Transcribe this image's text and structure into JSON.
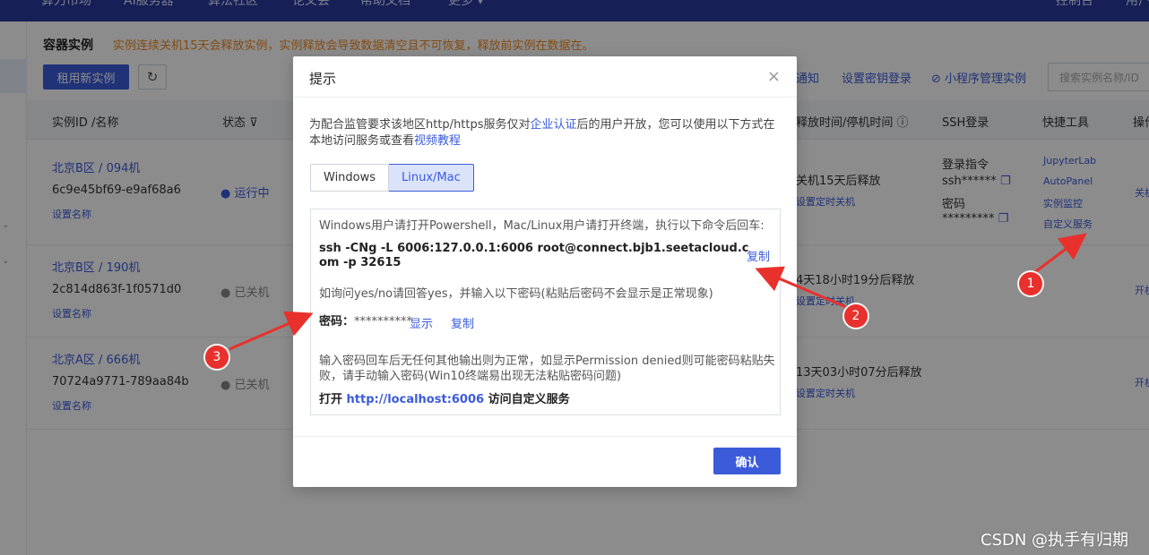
{
  "topnav": {
    "items": [
      "算力市场",
      "AI服务器",
      "算法社区",
      "论文会",
      "帮助文档",
      "更多 ▾"
    ],
    "right_items": [
      "控制台",
      "用户"
    ]
  },
  "page": {
    "title": "容器实例",
    "warning": "实例连续关机15天会释放实例，实例释放会导致数据清空且不可恢复，释放前实例在数据在。",
    "rent_button": "租用新实例",
    "refresh_icon": "refresh-icon",
    "right_links": [
      "通知",
      "设置密钥登录",
      "小程序管理实例"
    ],
    "search_placeholder": "搜索实例名称/ID"
  },
  "table": {
    "headers": [
      "实例ID /名称",
      "状态",
      "释放时间/停机时间",
      "SSH登录",
      "快捷工具",
      "操作"
    ],
    "rows": [
      {
        "region": "北京B区 / 094机",
        "id": "6c9e45bf69-e9af68a6",
        "set_name": "设置名称",
        "status": "运行中",
        "release": "关机15天后释放",
        "schedule": "设置定时关机",
        "ssh_login_label": "登录指令",
        "ssh_cmd": "ssh******",
        "password_label": "密码",
        "password_value": "*********",
        "tools": [
          "JupyterLab",
          "AutoPanel",
          "实例监控",
          "自定义服务"
        ],
        "action": "关机"
      },
      {
        "region": "北京B区 / 190机",
        "id": "2c814d863f-1f0571d0",
        "set_name": "设置名称",
        "status": "已关机",
        "release": "4天18小时19分后释放",
        "schedule": "设置定时关机",
        "action": "开机"
      },
      {
        "region": "北京A区 / 666机",
        "id": "70724a9771-789aa84b",
        "set_name": "设置名称",
        "status": "已关机",
        "release": "13天03小时07分后释放",
        "schedule": "设置定时关机",
        "action": "开机"
      }
    ]
  },
  "modal": {
    "title": "提示",
    "close_icon": "close-icon",
    "intro_prefix": "为配合监管要求该地区http/https服务仅对",
    "intro_link1": "企业认证",
    "intro_middle": "后的用户开放，您可以使用以下方式在本地访问服务或查看",
    "intro_link2": "视频教程",
    "tabs": [
      "Windows",
      "Linux/Mac"
    ],
    "active_tab": "Linux/Mac",
    "line1": "Windows用户请打开Powershell，Mac/Linux用户请打开终端，执行以下命令后回车:",
    "ssh_command": "ssh -CNg -L 6006:127.0.0.1:6006 root@connect.bjb1.seetacloud.com -p 32615",
    "copy_label": "复制",
    "line2": "如询问yes/no请回答yes，并输入以下密码(粘贴后密码不会显示是正常现象)",
    "password_label": "密码：",
    "password_value": "**********",
    "show_label": "显示",
    "copy_label2": "复制",
    "line3": "输入密码回车后无任何其他输出则为正常，如显示Permission denied则可能密码粘贴失败，请手动输入密码(Win10终端易出现无法粘贴密码问题)",
    "open_prefix": "打开",
    "open_url": "http://localhost:6006",
    "open_suffix": "访问自定义服务",
    "ok_button": "确认"
  },
  "annotations": {
    "badges": [
      "1",
      "2",
      "3"
    ],
    "color": "#e8312d"
  },
  "watermark": "CSDN @执手有归期"
}
